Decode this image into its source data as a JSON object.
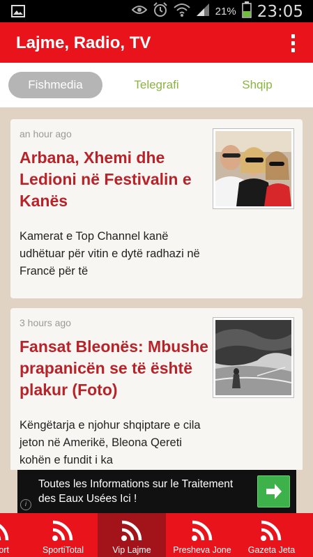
{
  "status_bar": {
    "battery_percent": "21%",
    "time": "23:05"
  },
  "app_bar": {
    "title": "Lajme, Radio, TV"
  },
  "tabs": [
    {
      "label": "Fishmedia",
      "active": true
    },
    {
      "label": "Telegrafi",
      "active": false
    },
    {
      "label": "Shqip",
      "active": false
    }
  ],
  "articles": [
    {
      "time": "an hour ago",
      "title": "Arbana, Xhemi dhe Ledioni në Festivalin e Kanës",
      "snippet": "Kamerat e Top Channel kanë udhëtuar për vitin e dytë radhazi në Francë për të"
    },
    {
      "time": "3 hours ago",
      "title": "Fansat Bleonës: Mbushe prapanicën se të është plakur (Foto)",
      "snippet": "Këngëtarja e njohur shqiptare e cila jeton në Amerikë, Bleona Qereti kohën e fundit i ka"
    }
  ],
  "ad": {
    "text": "Toutes les Informations sur le Traitement des Eaux Usées Ici !",
    "info_label": "i"
  },
  "bottom_nav": [
    {
      "label": "Sport",
      "active": false
    },
    {
      "label": "SportiTotal",
      "active": false
    },
    {
      "label": "Vip Lajme",
      "active": true
    },
    {
      "label": "Presheva Jone",
      "active": false
    },
    {
      "label": "Gazeta Jeta",
      "active": false
    }
  ],
  "colors": {
    "accent": "#e9141b",
    "title_red": "#b8232a",
    "tab_green": "#8ab440",
    "ad_button": "#3db24a"
  }
}
